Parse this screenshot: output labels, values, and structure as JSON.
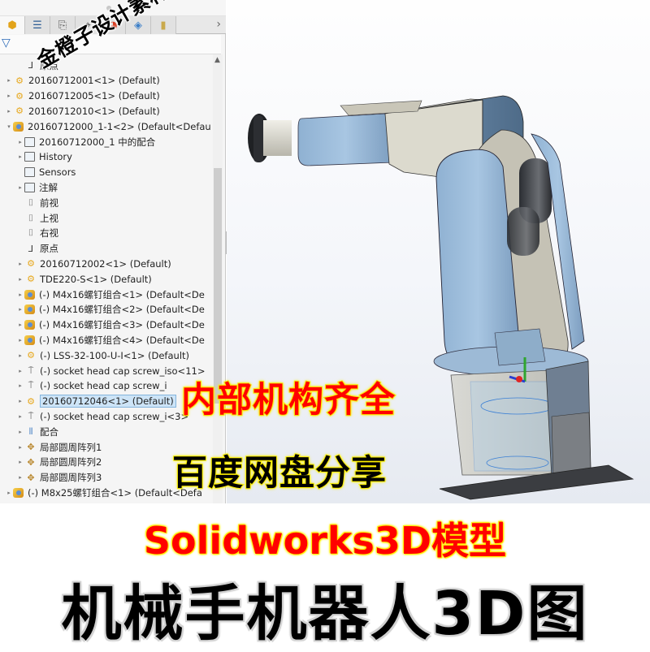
{
  "panel": {
    "tabs": [
      {
        "name": "featuremanager",
        "icon": "⬢"
      },
      {
        "name": "propertymanager",
        "icon": "☰"
      },
      {
        "name": "configurationmanager",
        "icon": "⎘"
      },
      {
        "name": "dimxpert",
        "icon": "⌖"
      },
      {
        "name": "display-manager",
        "icon": "◕"
      },
      {
        "name": "cam",
        "icon": "◈"
      },
      {
        "name": "extra",
        "icon": "▮"
      }
    ],
    "more_icon": "›",
    "filter_icon": "▽"
  },
  "tree": [
    {
      "indent": 1,
      "arrow": "",
      "icon": "origin",
      "label": "原点"
    },
    {
      "indent": 0,
      "arrow": "▸",
      "icon": "asm",
      "label": "20160712001<1> (Default)"
    },
    {
      "indent": 0,
      "arrow": "▸",
      "icon": "asm",
      "label": "20160712005<1> (Default)"
    },
    {
      "indent": 0,
      "arrow": "▸",
      "icon": "asm",
      "label": "20160712010<1> (Default)"
    },
    {
      "indent": 0,
      "arrow": "▾",
      "icon": "part",
      "label": "20160712000_1-1<2> (Default<Defau"
    },
    {
      "indent": 1,
      "arrow": "▸",
      "icon": "folder",
      "label": "20160712000_1 中的配合"
    },
    {
      "indent": 1,
      "arrow": "▸",
      "icon": "folder",
      "label": "History"
    },
    {
      "indent": 1,
      "arrow": "",
      "icon": "folder",
      "label": "Sensors"
    },
    {
      "indent": 1,
      "arrow": "▸",
      "icon": "folder",
      "label": "注解"
    },
    {
      "indent": 1,
      "arrow": "",
      "icon": "plane",
      "label": "前视"
    },
    {
      "indent": 1,
      "arrow": "",
      "icon": "plane",
      "label": "上视"
    },
    {
      "indent": 1,
      "arrow": "",
      "icon": "plane",
      "label": "右视"
    },
    {
      "indent": 1,
      "arrow": "",
      "icon": "origin",
      "label": "原点"
    },
    {
      "indent": 1,
      "arrow": "▸",
      "icon": "asm",
      "label": "20160712002<1> (Default)"
    },
    {
      "indent": 1,
      "arrow": "▸",
      "icon": "asm",
      "label": "TDE220-S<1> (Default)"
    },
    {
      "indent": 1,
      "arrow": "▸",
      "icon": "part",
      "label": "(-) M4x16螺钉组合<1> (Default<De"
    },
    {
      "indent": 1,
      "arrow": "▸",
      "icon": "part",
      "label": "(-) M4x16螺钉组合<2> (Default<De"
    },
    {
      "indent": 1,
      "arrow": "▸",
      "icon": "part",
      "label": "(-) M4x16螺钉组合<3> (Default<De"
    },
    {
      "indent": 1,
      "arrow": "▸",
      "icon": "part",
      "label": "(-) M4x16螺钉组合<4> (Default<De"
    },
    {
      "indent": 1,
      "arrow": "▸",
      "icon": "asm",
      "label": "(-) LSS-32-100-U-I<1> (Default)"
    },
    {
      "indent": 1,
      "arrow": "▸",
      "icon": "screw",
      "label": "(-) socket head cap screw_iso<11>"
    },
    {
      "indent": 1,
      "arrow": "▸",
      "icon": "screw",
      "label": "(-) socket head cap screw_i"
    },
    {
      "indent": 1,
      "arrow": "▸",
      "icon": "asm",
      "label": "20160712046<1> (Default)",
      "selected": true
    },
    {
      "indent": 1,
      "arrow": "▸",
      "icon": "screw",
      "label": "(-) socket head cap screw_i<3>"
    },
    {
      "indent": 1,
      "arrow": "▸",
      "icon": "mates",
      "label": "配合"
    },
    {
      "indent": 1,
      "arrow": "▸",
      "icon": "pattern",
      "label": "局部圆周阵列1"
    },
    {
      "indent": 1,
      "arrow": "▸",
      "icon": "pattern",
      "label": "局部圆周阵列2"
    },
    {
      "indent": 1,
      "arrow": "▸",
      "icon": "pattern",
      "label": "局部圆周阵列3"
    },
    {
      "indent": 0,
      "arrow": "▸",
      "icon": "part",
      "label": "(-) M8x25螺钉组合<1> (Default<Defa"
    }
  ],
  "overlays": {
    "watermark": "金橙子设计素材基地",
    "feature_text": "内部机构齐全",
    "share_text": "百度网盘分享"
  },
  "banner": {
    "line1": "Solidworks3D模型",
    "line2": "机械手机器人3D图"
  },
  "colors": {
    "robot_blue": "#9bbcd9",
    "robot_grey": "#dcdad0",
    "highlight_red": "#ff0000",
    "highlight_yellow": "#f4ee00"
  }
}
